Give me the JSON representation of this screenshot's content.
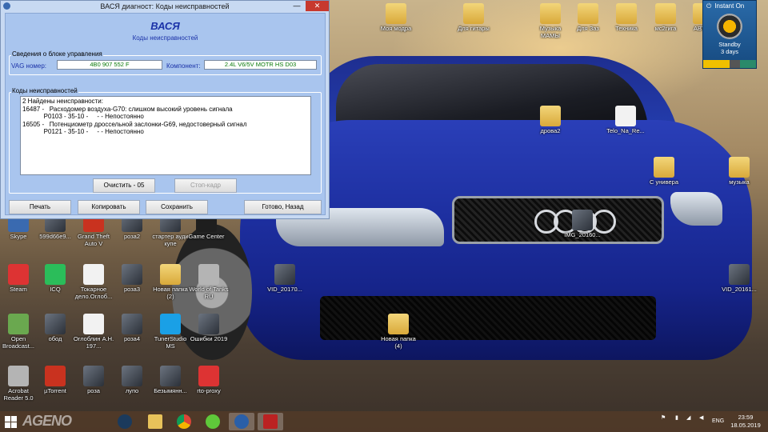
{
  "window": {
    "title": "ВАСЯ диагност: Коды неисправностей",
    "min_glyph": "—",
    "close_glyph": "✕",
    "app_name": "ВАСЯ",
    "subtitle": "Коды неисправностей",
    "group_info_label": "Сведения о блоке управления",
    "vag_label": "VAG номер:",
    "vag_value": "4B0 907 552 F",
    "component_label": "Компонент:",
    "component_value": "2.4L V6/5V  MOTR HS D03",
    "group_codes_label": "Коды неисправностей",
    "codes_lines": [
      "2 Найдены неисправности:",
      "16487 -   Расходомер воздуха-G70: слишком высокий уровень сигнала",
      "            P0103 - 35-10 -     - - Непостоянно",
      "16505 -   Потенциометр дроссельной заслонки-G69, недостоверный сигнал",
      "            P0121 - 35-10 -     - - Непостоянно"
    ],
    "btn_clear": "Очистить - 05",
    "btn_freeze": "Стоп-кадр",
    "btn_print": "Печать",
    "btn_copy": "Копировать",
    "btn_save": "Сохранить",
    "btn_done": "Готово, Назад"
  },
  "instant_on": {
    "title": "Instant On",
    "state": "Standby",
    "duration": "3 days"
  },
  "desktop_icons": [
    {
      "label": "Моя модра",
      "kind": "folder"
    },
    {
      "label": "Для гитары",
      "kind": "folder"
    },
    {
      "label": "Музыка МАМЫ",
      "kind": "folder"
    },
    {
      "label": "Для Заз",
      "kind": "folder"
    },
    {
      "label": "Техника",
      "kind": "folder"
    },
    {
      "label": "мс2гига",
      "kind": "folder"
    },
    {
      "label": "АВТОК",
      "kind": "folder"
    },
    {
      "label": "дрова2",
      "kind": "folder"
    },
    {
      "label": "Telo_Na_Re...",
      "kind": "doc"
    },
    {
      "label": "С универа",
      "kind": "folder"
    },
    {
      "label": "музыка",
      "kind": "folder"
    },
    {
      "label": "IMG_20160...",
      "kind": "pic"
    },
    {
      "label": "Skype",
      "kind": "app"
    },
    {
      "label": "599d66e9...",
      "kind": "pic"
    },
    {
      "label": "Grand Theft Auto V",
      "kind": "app"
    },
    {
      "label": "роза2",
      "kind": "pic"
    },
    {
      "label": "стартер ауди купе",
      "kind": "pic"
    },
    {
      "label": "Game Center",
      "kind": "app"
    },
    {
      "label": "Steam",
      "kind": "app"
    },
    {
      "label": "ICQ",
      "kind": "app"
    },
    {
      "label": "Токарное дело.Оглоб...",
      "kind": "doc"
    },
    {
      "label": "роза3",
      "kind": "pic"
    },
    {
      "label": "Новая папка (2)",
      "kind": "folder"
    },
    {
      "label": "World of Tanks RU",
      "kind": "app"
    },
    {
      "label": "VID_20170...",
      "kind": "pic"
    },
    {
      "label": "VID_20161...",
      "kind": "pic"
    },
    {
      "label": "Open Broadcast...",
      "kind": "app"
    },
    {
      "label": "обод",
      "kind": "pic"
    },
    {
      "label": "Оглоблин А.Н. 197...",
      "kind": "doc"
    },
    {
      "label": "роза4",
      "kind": "pic"
    },
    {
      "label": "TunerStudio MS",
      "kind": "app"
    },
    {
      "label": "Ошибки 2019",
      "kind": "pic"
    },
    {
      "label": "Новая папка (4)",
      "kind": "folder"
    },
    {
      "label": "Acrobat Reader 5.0",
      "kind": "app"
    },
    {
      "label": "µTorrent",
      "kind": "app"
    },
    {
      "label": "роза",
      "kind": "pic"
    },
    {
      "label": "лупо",
      "kind": "pic"
    },
    {
      "label": "Безымянн...",
      "kind": "pic"
    },
    {
      "label": "rto-proxy",
      "kind": "app"
    }
  ],
  "taskbar": {
    "watermark": "AGENO",
    "lang": "ENG",
    "time": "23:59",
    "date": "18.05.2019"
  }
}
